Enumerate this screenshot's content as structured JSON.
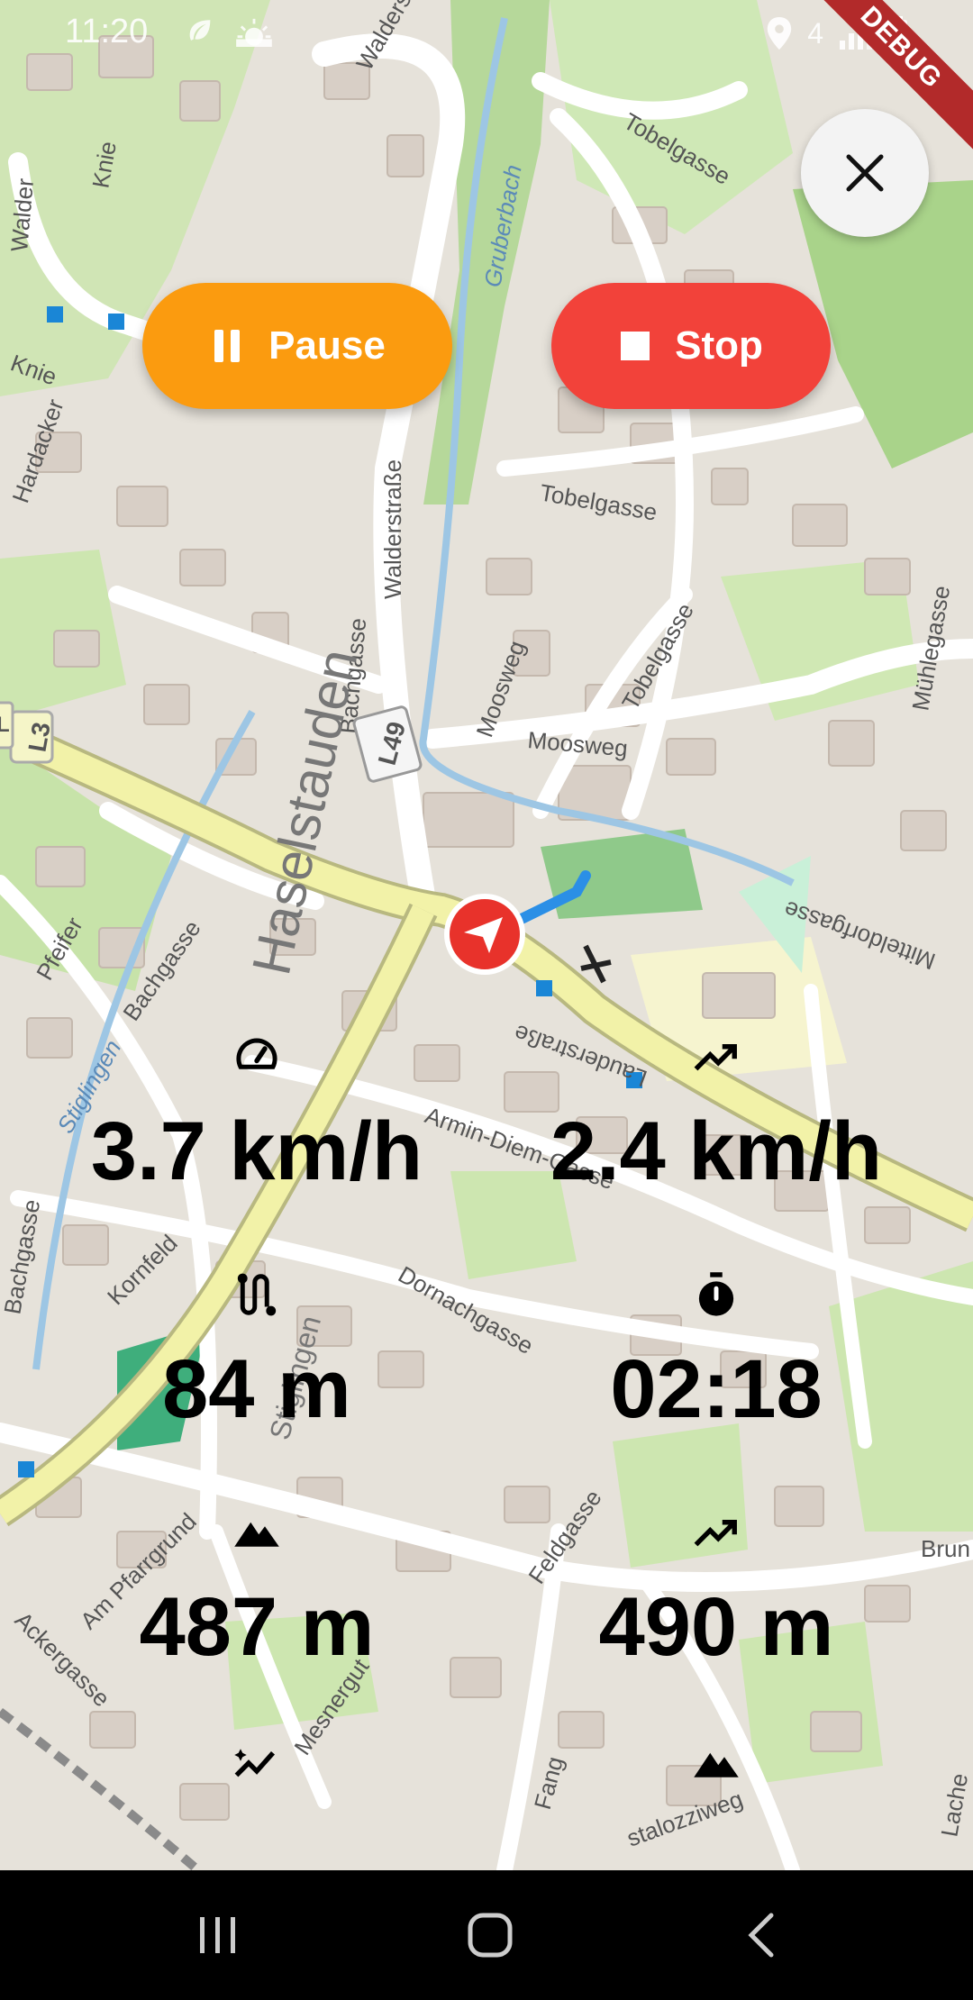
{
  "status_bar": {
    "time": "11:20",
    "battery_text": "4"
  },
  "debug_banner": "DEBUG",
  "buttons": {
    "pause_label": "Pause",
    "stop_label": "Stop"
  },
  "map_labels": {
    "walderstrasse_top": "Walderstraße",
    "walderstrasse_mid": "Walderstraße",
    "walder": "Walder",
    "knie1": "Knie",
    "knie2": "Knie",
    "tobelgasse1": "Tobelgasse",
    "tobelgasse2": "Tobelgasse",
    "tobelgasse3": "Tobelgasse",
    "gruberbach": "Gruberbach",
    "hardacker": "Hardacker",
    "bachgasse1": "Bachgasse",
    "bachgasse2": "Bachgasse",
    "bachgasse3": "Bachgasse",
    "moosweg1": "Moosweg",
    "moosweg2": "Moosweg",
    "l49": "L49",
    "l3": "L3",
    "l": "L",
    "haselstauden": "Haselstauden",
    "stiglingen": "Stiglingen",
    "stiglingen_river": "Stiglingen",
    "pfeifer": "Pfeifer",
    "armin": "Armin-Diem-Gasse",
    "lauderstrasse": "Lauderstraße",
    "mitteldorfgasse": "Mitteldorfgasse",
    "muhlegasse": "Mühlegasse",
    "kornfeld": "Kornfeld",
    "dornachgasse": "Dornachgasse",
    "feldgasse": "Feldgasse",
    "am_pfarrgrund": "Am Pfarrgrund",
    "ackergasse": "Ackergasse",
    "mesnergut": "Mesnergut",
    "fang": "Fang",
    "stalozziweg": "stalozziweg",
    "brun": "Brun",
    "lache": "Lache"
  },
  "stats": {
    "speed": "3.7 km/h",
    "avg_speed": "2.4 km/h",
    "distance": "84 m",
    "duration": "02:18",
    "altitude": "487 m",
    "max_altitude": "490 m"
  },
  "icons": {
    "speed": "speedometer-icon",
    "avg_speed": "trending-up-icon",
    "distance": "route-icon",
    "duration": "stopwatch-icon",
    "altitude": "mountain-icon",
    "max_altitude": "trending-up-icon",
    "ascent": "auto-graph-icon",
    "descent": "mountain-icon"
  },
  "colors": {
    "pause": "#fb9b0f",
    "stop": "#f2423a",
    "track": "#2b8fe6",
    "location": "#e8322b",
    "main_road": "#f2f2a8"
  }
}
